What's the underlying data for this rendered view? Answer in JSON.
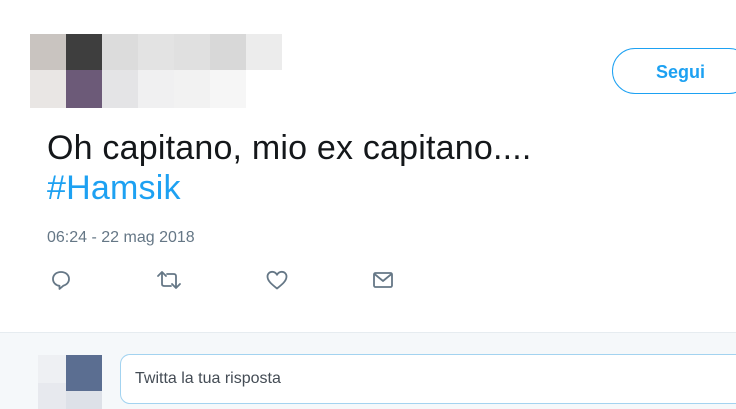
{
  "tweet": {
    "follow_label": "Segui",
    "text": "Oh capitano, mio ex capitano....",
    "hashtag": "#Hamsik",
    "timestamp": "06:24 - 22 mag 2018"
  },
  "actions": {
    "reply_icon": "reply-icon",
    "retweet_icon": "retweet-icon",
    "like_icon": "heart-icon",
    "message_icon": "envelope-icon"
  },
  "reply": {
    "placeholder": "Twitta la tua risposta"
  },
  "colors": {
    "accent": "#1da1f2",
    "text": "#14171a",
    "muted": "#657786",
    "reply_bg": "#f5f8fa",
    "divider": "#e6ecf0"
  }
}
